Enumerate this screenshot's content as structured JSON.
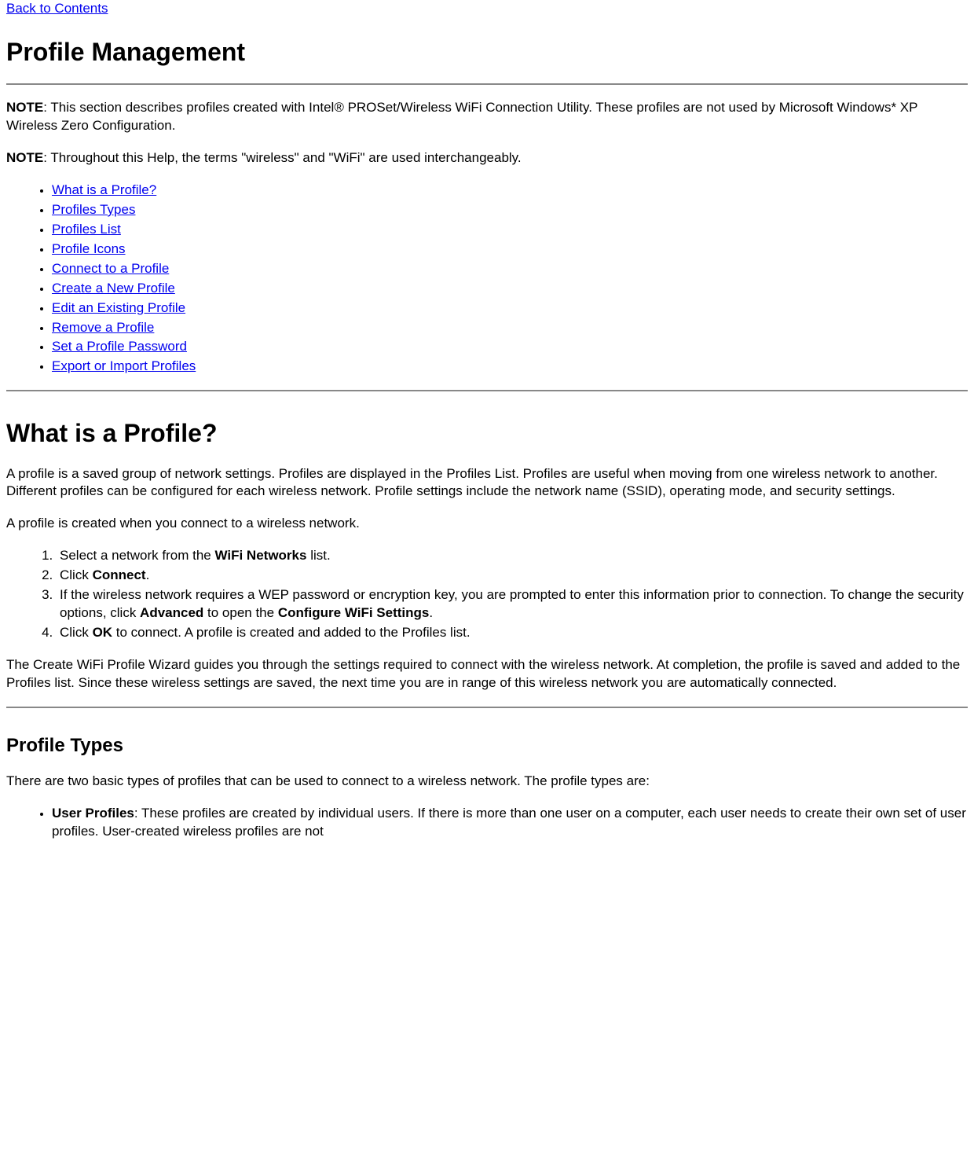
{
  "nav": {
    "back_to_contents": "Back to Contents"
  },
  "headings": {
    "h1": "Profile Management",
    "h2": "What is a Profile?",
    "h3": "Profile Types"
  },
  "notes": {
    "note1_label": "NOTE",
    "note1_text": ": This section describes profiles created with Intel® PROSet/Wireless WiFi Connection Utility. These profiles are not used by Microsoft Windows* XP Wireless Zero Configuration.",
    "note2_label": "NOTE",
    "note2_text": ": Throughout this Help, the terms \"wireless\" and \"WiFi\" are used interchangeably."
  },
  "toc": [
    "What is a Profile?",
    "Profiles Types",
    "Profiles List",
    "Profile Icons",
    "Connect to a Profile",
    "Create a New Profile",
    "Edit an Existing Profile",
    "Remove a Profile",
    "Set a Profile Password",
    "Export or Import Profiles"
  ],
  "what_is": {
    "para1": "A profile is a saved group of network settings. Profiles are displayed in the Profiles List. Profiles are useful when moving from one wireless network to another. Different profiles can be configured for each wireless network. Profile settings include the network name (SSID), operating mode, and security settings.",
    "para2": "A profile is created when you connect to a wireless network.",
    "steps": {
      "s1a": "Select a network from the ",
      "s1b": "WiFi Networks",
      "s1c": " list.",
      "s2a": "Click ",
      "s2b": "Connect",
      "s2c": ".",
      "s3a": "If the wireless network requires a WEP password or encryption key, you are prompted to enter this information prior to connection. To change the security options, click ",
      "s3b": "Advanced",
      "s3c": " to open the ",
      "s3d": "Configure WiFi Settings",
      "s3e": ".",
      "s4a": "Click ",
      "s4b": "OK",
      "s4c": " to connect. A profile is created and added to the Profiles list."
    },
    "para3": "The Create WiFi Profile Wizard guides you through the settings required to connect with the wireless network. At completion, the profile is saved and added to the Profiles list. Since these wireless settings are saved, the next time you are in range of this wireless network you are automatically connected."
  },
  "profile_types": {
    "para": "There are two basic types of profiles that can be used to connect to a wireless network. The profile types are:",
    "user_label": "User Profiles",
    "user_text": ": These profiles are created by individual users. If there is more than one user on a computer, each user needs to create their own set of user profiles. User-created wireless profiles are not"
  }
}
